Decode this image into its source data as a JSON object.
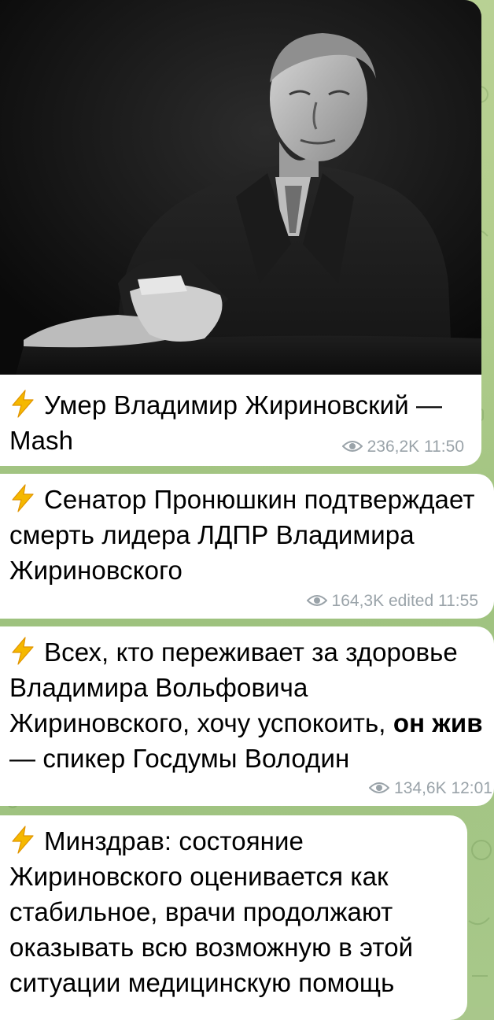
{
  "messages": [
    {
      "text": "Умер Владимир Жириновский — Mash",
      "views": "236,2K",
      "time": "11:50",
      "edited": ""
    },
    {
      "text": "Сенатор Пронюшкин подтверждает смерть лидера ЛДПР Владимира Жириновского",
      "views": "164,3K",
      "time": "11:55",
      "edited": "edited"
    },
    {
      "text_before": "Всех, кто переживает за здоровье Владимира Вольфовича Жириновского, хочу успокоить,",
      "text_bold": "он жив",
      "text_after": "— спикер Госдумы Володин",
      "views": "134,6K",
      "time": "12:01",
      "edited": ""
    },
    {
      "text": "Минздрав: состояние Жириновского оценивается как стабильное, врачи продолжают оказывать всю возможную в этой ситуации медицинскую помощь"
    }
  ],
  "colors": {
    "bolt": "#f5b800",
    "meta": "#9aa3a9",
    "bubble": "#ffffff",
    "wallpaper": "#a9c78b"
  },
  "icons": {
    "bolt": "high-voltage-emoji",
    "views": "eye-icon"
  }
}
